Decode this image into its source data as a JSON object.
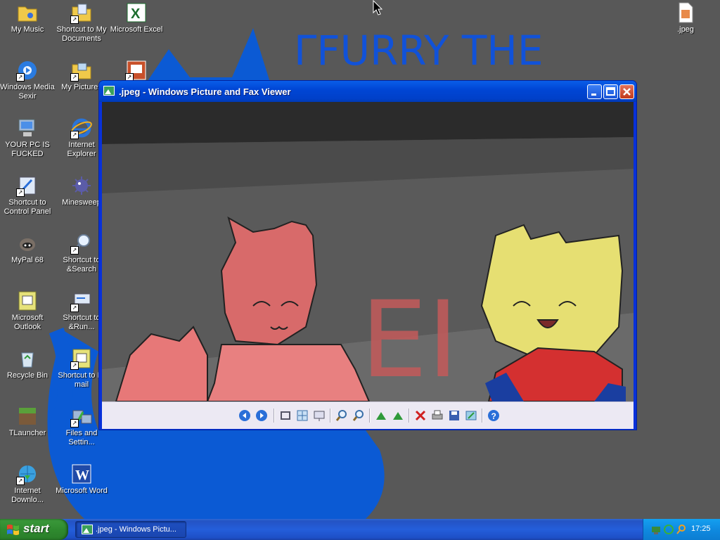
{
  "desktop": {
    "wallpaper_text": "ΓFURRY THE",
    "icons": [
      {
        "id": "my-music",
        "label": "My Music"
      },
      {
        "id": "shortcut-my-documents",
        "label": "Shortcut to My Documents"
      },
      {
        "id": "microsoft-excel",
        "label": "Microsoft Excel"
      },
      {
        "id": "jpeg-file",
        "label": ".jpeg"
      },
      {
        "id": "windows-media",
        "label": "Windows Media Sexir"
      },
      {
        "id": "my-pictures",
        "label": "My Pictures"
      },
      {
        "id": "your-pc",
        "label": "YOUR PC IS FUCKED"
      },
      {
        "id": "internet-explorer",
        "label": "Internet Explorer"
      },
      {
        "id": "control-panel",
        "label": "Shortcut to Control Panel"
      },
      {
        "id": "minesweeper",
        "label": "Minesweep"
      },
      {
        "id": "mypal",
        "label": "MyPal 68"
      },
      {
        "id": "search",
        "label": "Shortcut to &Search"
      },
      {
        "id": "outlook",
        "label": "Microsoft Outlook"
      },
      {
        "id": "run",
        "label": "Shortcut to &Run..."
      },
      {
        "id": "recycle-bin",
        "label": "Recycle Bin"
      },
      {
        "id": "email",
        "label": "Shortcut to E-mail"
      },
      {
        "id": "tlauncher",
        "label": "TLauncher"
      },
      {
        "id": "files-settings",
        "label": "Files and Settin..."
      },
      {
        "id": "internet-download",
        "label": "Internet Downlo..."
      },
      {
        "id": "microsoft-word",
        "label": "Microsoft Word"
      }
    ]
  },
  "window": {
    "title": ".jpeg - Windows Picture and Fax Viewer",
    "image_text": "EI",
    "toolbar_icons": [
      "previous-image-icon",
      "next-image-icon",
      "best-fit-icon",
      "actual-size-icon",
      "slideshow-icon",
      "zoom-in-icon",
      "zoom-out-icon",
      "rotate-clockwise-icon",
      "rotate-counterclockwise-icon",
      "delete-icon",
      "print-icon",
      "save-icon",
      "edit-icon",
      "help-icon"
    ]
  },
  "taskbar": {
    "start_label": "start",
    "task_label": ".jpeg - Windows Pictu...",
    "clock": "17:25"
  },
  "colors": {
    "taskbar_blue": "#245edb",
    "start_green": "#3c9a3c",
    "wallpaper_blue": "#0b5ad4",
    "title_blue": "#0046d5"
  }
}
